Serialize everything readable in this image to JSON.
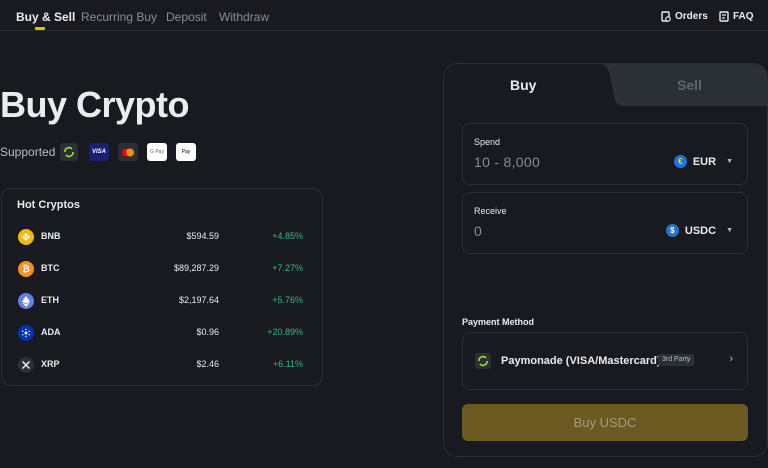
{
  "nav": {
    "tabs": [
      "Buy & Sell",
      "Recurring Buy",
      "Deposit",
      "Withdraw"
    ],
    "active_tab": "Buy & Sell",
    "orders_label": "Orders",
    "faq_label": "FAQ"
  },
  "hero": {
    "title": "Buy Crypto",
    "supported_label": "Supported",
    "payment_icons": [
      "paymonade-icon",
      "visa-icon",
      "mastercard-icon",
      "google-pay-icon",
      "apple-pay-icon"
    ],
    "visa_text": "VISA",
    "gpay_text": "G Pay",
    "applepay_text": "Pay"
  },
  "hot_cryptos": {
    "title": "Hot Cryptos",
    "rows": [
      {
        "symbol": "BNB",
        "price": "$594.59",
        "change": "+4.85%",
        "icon": "bnb-icon",
        "color": "#f0b90b"
      },
      {
        "symbol": "BTC",
        "price": "$89,287.29",
        "change": "+7.27%",
        "icon": "btc-icon",
        "color": "#f7931a"
      },
      {
        "symbol": "ETH",
        "price": "$2,197.64",
        "change": "+5.76%",
        "icon": "eth-icon",
        "color": "#627eea"
      },
      {
        "symbol": "ADA",
        "price": "$0.96",
        "change": "+20.89%",
        "icon": "ada-icon",
        "color": "#0033ad"
      },
      {
        "symbol": "XRP",
        "price": "$2.46",
        "change": "+6.11%",
        "icon": "xrp-icon",
        "color": "#23292f"
      }
    ]
  },
  "trade": {
    "buy_tab": "Buy",
    "sell_tab": "Sell",
    "spend": {
      "label": "Spend",
      "placeholder": "10 - 8,000",
      "currency": "EUR"
    },
    "receive": {
      "label": "Receive",
      "value": "0",
      "currency": "USDC"
    },
    "payment_method_label": "Payment Method",
    "payment_method": {
      "name": "Paymonade (VISA/Mastercard)",
      "badge": "3rd Party"
    },
    "submit_label": "Buy USDC"
  },
  "colors": {
    "background": "#181a20",
    "accent": "#f0b90b",
    "positive": "#2ebd85",
    "button": "#6b5a22"
  }
}
